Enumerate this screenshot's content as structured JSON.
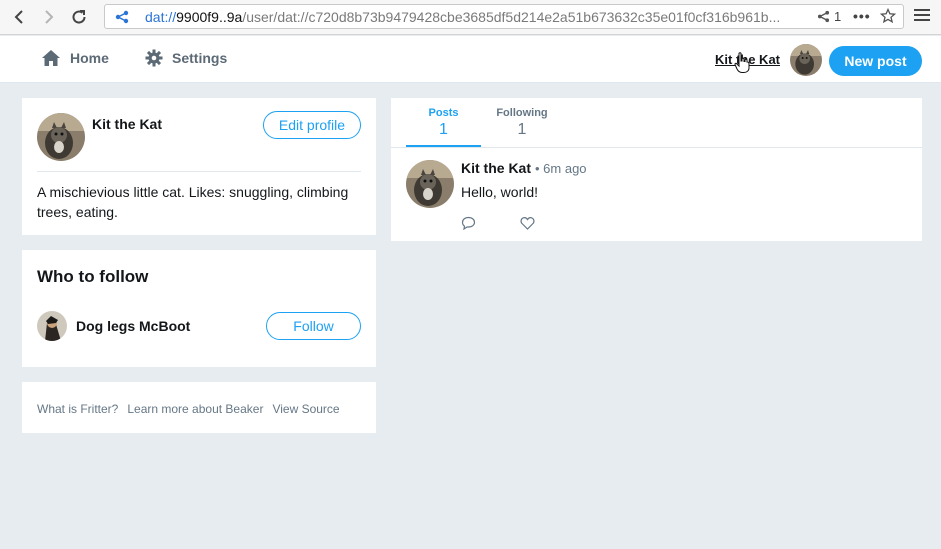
{
  "browser": {
    "url_protocol": "dat://",
    "url_host": "9900f9..9a",
    "url_path": "/user/dat://c720d8b73b9479428cbe3685df5d214e2a51b673632c35e01f0cf316b961b...",
    "peer_count": "1"
  },
  "header": {
    "home_label": "Home",
    "settings_label": "Settings",
    "user_link": "Kit the Kat",
    "new_post_label": "New post"
  },
  "profile": {
    "name": "Kit the Kat",
    "edit_label": "Edit profile",
    "bio": "A mischievious little cat. Likes: snuggling, climbing trees, eating."
  },
  "who_to_follow": {
    "title": "Who to follow",
    "user_name": "Dog legs McBoot",
    "follow_label": "Follow"
  },
  "footer_links": [
    "What is Fritter?",
    "Learn more about Beaker",
    "View Source"
  ],
  "tabs": [
    {
      "label": "Posts",
      "count": "1"
    },
    {
      "label": "Following",
      "count": "1"
    }
  ],
  "post": {
    "author": "Kit the Kat",
    "time": "• 6m ago",
    "text": "Hello, world!"
  },
  "colors": {
    "accent": "#1da1f2",
    "background": "#e6ecf0"
  }
}
